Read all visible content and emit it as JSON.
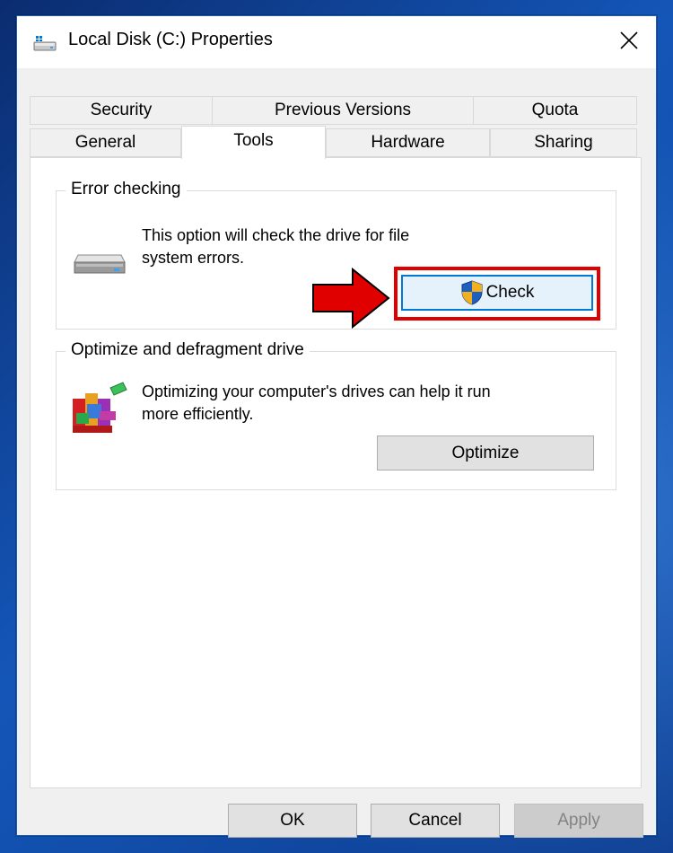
{
  "window": {
    "title": "Local Disk (C:) Properties"
  },
  "tabs": {
    "row_top": [
      {
        "label": "Security"
      },
      {
        "label": "Previous Versions"
      },
      {
        "label": "Quota"
      }
    ],
    "row_bottom": [
      {
        "label": "General"
      },
      {
        "label": "Tools",
        "selected": true
      },
      {
        "label": "Hardware"
      },
      {
        "label": "Sharing"
      }
    ]
  },
  "error_checking": {
    "group_title": "Error checking",
    "description_line1": "This option will check the drive for file",
    "description_line2": "system errors.",
    "check_label": "Check"
  },
  "optimize": {
    "group_title": "Optimize and defragment drive",
    "description_line1": "Optimizing your computer's drives can help it run",
    "description_line2": "more efficiently.",
    "optimize_label": "Optimize"
  },
  "footer": {
    "ok_label": "OK",
    "cancel_label": "Cancel",
    "apply_label": "Apply"
  },
  "colors": {
    "annotation_red": "#e00000",
    "focus_blue": "#0078d7",
    "shield_blue": "#1f5fbf",
    "shield_gold": "#f2b01e"
  },
  "icons": {
    "title": "drive-icon",
    "close": "close-icon",
    "error_checking": "hard-drive-icon",
    "check_button": "uac-shield-icon",
    "optimize": "defragment-icon",
    "annotation": "red-arrow-icon"
  }
}
